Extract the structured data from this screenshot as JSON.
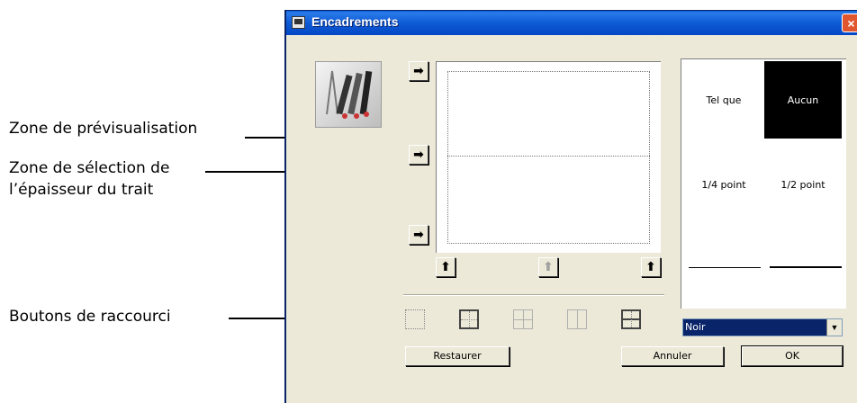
{
  "annotations": {
    "preview_zone": "Zone de prévisualisation",
    "thickness_zone_line1": "Zone de sélection de",
    "thickness_zone_line2": "l’épaisseur du trait",
    "shortcut_buttons": "Boutons de raccourci"
  },
  "dialog": {
    "title": "Encadrements",
    "close_glyph": "×",
    "arrow_right_glyph": "➡",
    "arrow_up_glyph": "⬆"
  },
  "thickness": {
    "options": [
      "Tel que",
      "Aucun",
      "1/4 point",
      "1/2 point"
    ],
    "selected": "Aucun"
  },
  "color": {
    "selected": "Noir",
    "dropdown_glyph": "▼"
  },
  "buttons": {
    "restore": "Restaurer",
    "cancel": "Annuler",
    "ok": "OK"
  }
}
